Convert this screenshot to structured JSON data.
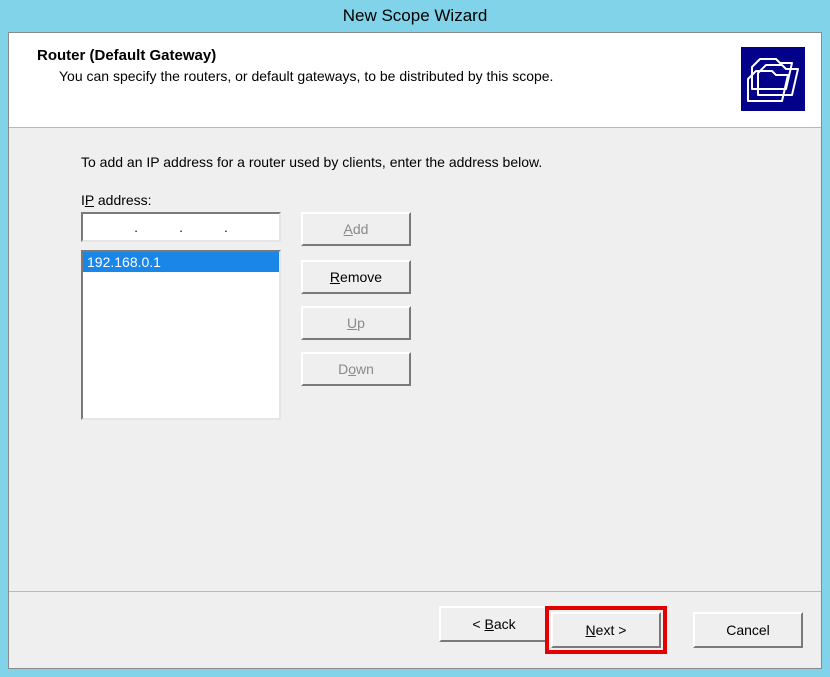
{
  "window": {
    "title": "New Scope Wizard"
  },
  "header": {
    "title": "Router (Default Gateway)",
    "subtitle": "You can specify the routers, or default gateways, to be distributed by this scope."
  },
  "body": {
    "instruction": "To add an IP address for a router used by clients, enter the address below.",
    "ip_label_prefix": "I",
    "ip_label_underline": "P",
    "ip_label_suffix": " address:",
    "ip_value": "",
    "list_items": [
      "192.168.0.1"
    ]
  },
  "side_buttons": {
    "add_underline": "A",
    "add_rest": "dd",
    "remove_underline": "R",
    "remove_rest": "emove",
    "up_underline": "U",
    "up_rest": "p",
    "down_pre": "D",
    "down_underline": "o",
    "down_rest": "wn"
  },
  "footer": {
    "back_lt": "< ",
    "back_underline": "B",
    "back_rest": "ack",
    "next_underline": "N",
    "next_rest": "ext ",
    "next_gt": ">",
    "cancel": "Cancel"
  }
}
